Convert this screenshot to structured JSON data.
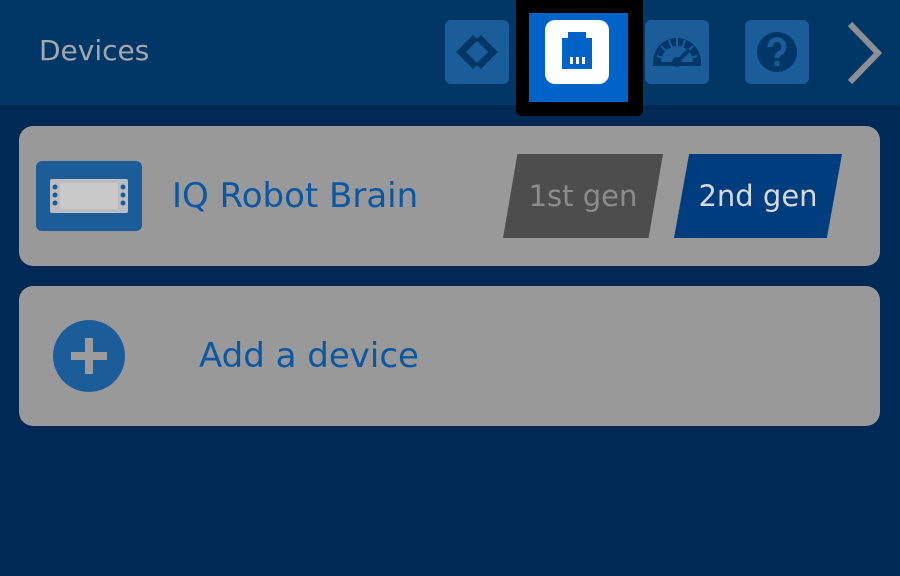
{
  "header": {
    "title": "Devices",
    "tabs": [
      {
        "icon": "code-icon",
        "active": false
      },
      {
        "icon": "port-icon",
        "active": true
      },
      {
        "icon": "dashboard-gauge-icon",
        "active": false
      },
      {
        "icon": "help-icon",
        "active": false
      }
    ],
    "next_icon": "chevron-right-icon"
  },
  "devices": [
    {
      "label": "IQ Robot Brain",
      "icon": "robot-brain-icon",
      "generations": [
        {
          "label": "1st gen",
          "selected": false
        },
        {
          "label": "2nd gen",
          "selected": true
        }
      ]
    }
  ],
  "add_device": {
    "label": "Add a device",
    "icon": "plus-circle-icon"
  },
  "colors": {
    "background": "#002a55",
    "header": "#003767",
    "accent": "#0063c7",
    "card": "#999999",
    "text_blue": "#0a58a4"
  }
}
